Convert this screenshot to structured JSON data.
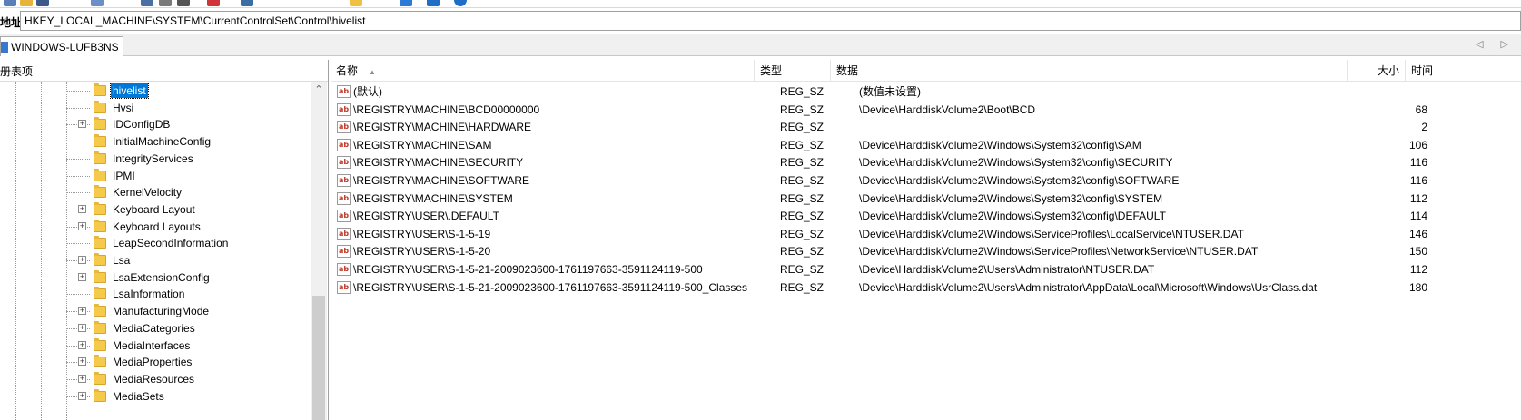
{
  "address": {
    "label": "地址",
    "path": "HKEY_LOCAL_MACHINE\\SYSTEM\\CurrentControlSet\\Control\\hivelist"
  },
  "connection_tab": {
    "label": "WINDOWS-LUFB3NS"
  },
  "tab_strip": {
    "arrows": "◁ ▷"
  },
  "tree": {
    "header": "注册表项",
    "items": [
      {
        "label": "hivelist",
        "expandable": false,
        "selected": true
      },
      {
        "label": "Hvsi",
        "expandable": false
      },
      {
        "label": "IDConfigDB",
        "expandable": true
      },
      {
        "label": "InitialMachineConfig",
        "expandable": false
      },
      {
        "label": "IntegrityServices",
        "expandable": false
      },
      {
        "label": "IPMI",
        "expandable": false
      },
      {
        "label": "KernelVelocity",
        "expandable": false
      },
      {
        "label": "Keyboard Layout",
        "expandable": true
      },
      {
        "label": "Keyboard Layouts",
        "expandable": true
      },
      {
        "label": "LeapSecondInformation",
        "expandable": false
      },
      {
        "label": "Lsa",
        "expandable": true
      },
      {
        "label": "LsaExtensionConfig",
        "expandable": true
      },
      {
        "label": "LsaInformation",
        "expandable": false
      },
      {
        "label": "ManufacturingMode",
        "expandable": true
      },
      {
        "label": "MediaCategories",
        "expandable": true
      },
      {
        "label": "MediaInterfaces",
        "expandable": true
      },
      {
        "label": "MediaProperties",
        "expandable": true
      },
      {
        "label": "MediaResources",
        "expandable": true
      },
      {
        "label": "MediaSets",
        "expandable": true
      }
    ]
  },
  "list": {
    "columns": {
      "name": "名称",
      "type": "类型",
      "data": "数据",
      "size": "大小",
      "time": "时间"
    },
    "rows": [
      {
        "name": "(默认)",
        "type": "REG_SZ",
        "data": "(数值未设置)",
        "size": ""
      },
      {
        "name": "\\REGISTRY\\MACHINE\\BCD00000000",
        "type": "REG_SZ",
        "data": "\\Device\\HarddiskVolume2\\Boot\\BCD",
        "size": "68"
      },
      {
        "name": "\\REGISTRY\\MACHINE\\HARDWARE",
        "type": "REG_SZ",
        "data": "",
        "size": "2"
      },
      {
        "name": "\\REGISTRY\\MACHINE\\SAM",
        "type": "REG_SZ",
        "data": "\\Device\\HarddiskVolume2\\Windows\\System32\\config\\SAM",
        "size": "106"
      },
      {
        "name": "\\REGISTRY\\MACHINE\\SECURITY",
        "type": "REG_SZ",
        "data": "\\Device\\HarddiskVolume2\\Windows\\System32\\config\\SECURITY",
        "size": "116"
      },
      {
        "name": "\\REGISTRY\\MACHINE\\SOFTWARE",
        "type": "REG_SZ",
        "data": "\\Device\\HarddiskVolume2\\Windows\\System32\\config\\SOFTWARE",
        "size": "116"
      },
      {
        "name": "\\REGISTRY\\MACHINE\\SYSTEM",
        "type": "REG_SZ",
        "data": "\\Device\\HarddiskVolume2\\Windows\\System32\\config\\SYSTEM",
        "size": "112"
      },
      {
        "name": "\\REGISTRY\\USER\\.DEFAULT",
        "type": "REG_SZ",
        "data": "\\Device\\HarddiskVolume2\\Windows\\System32\\config\\DEFAULT",
        "size": "114"
      },
      {
        "name": "\\REGISTRY\\USER\\S-1-5-19",
        "type": "REG_SZ",
        "data": "\\Device\\HarddiskVolume2\\Windows\\ServiceProfiles\\LocalService\\NTUSER.DAT",
        "size": "146"
      },
      {
        "name": "\\REGISTRY\\USER\\S-1-5-20",
        "type": "REG_SZ",
        "data": "\\Device\\HarddiskVolume2\\Windows\\ServiceProfiles\\NetworkService\\NTUSER.DAT",
        "size": "150"
      },
      {
        "name": "\\REGISTRY\\USER\\S-1-5-21-2009023600-1761197663-3591124119-500",
        "type": "REG_SZ",
        "data": "\\Device\\HarddiskVolume2\\Users\\Administrator\\NTUSER.DAT",
        "size": "112"
      },
      {
        "name": "\\REGISTRY\\USER\\S-1-5-21-2009023600-1761197663-3591124119-500_Classes",
        "type": "REG_SZ",
        "data": "\\Device\\HarddiskVolume2\\Users\\Administrator\\AppData\\Local\\Microsoft\\Windows\\UsrClass.dat",
        "size": "180"
      }
    ]
  },
  "colors": {
    "selection": "#0078d7",
    "folder": "#f5c94a"
  }
}
